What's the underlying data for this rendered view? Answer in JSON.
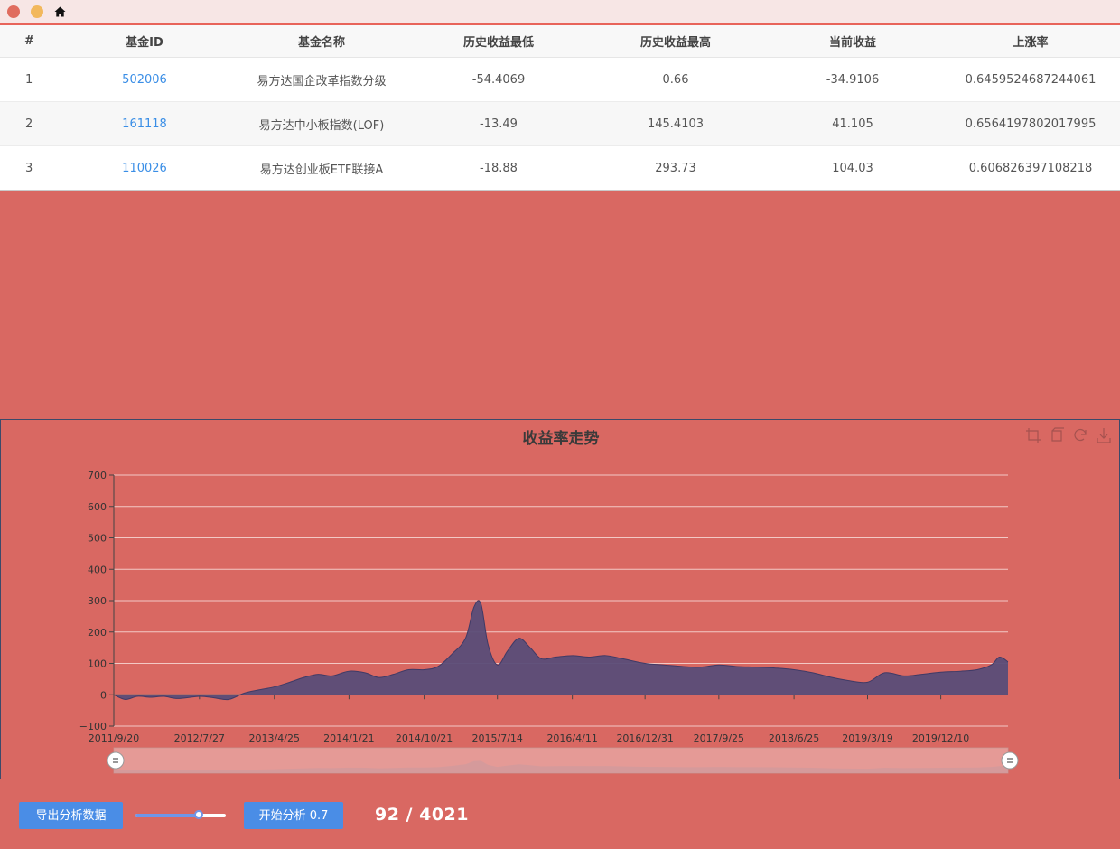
{
  "table": {
    "headers": [
      "#",
      "基金ID",
      "基金名称",
      "历史收益最低",
      "历史收益最高",
      "当前收益",
      "上涨率"
    ],
    "rows": [
      {
        "index": "1",
        "fund_id": "502006",
        "name": "易方达国企改革指数分级",
        "min": "-54.4069",
        "max": "0.66",
        "current": "-34.9106",
        "rate": "0.6459524687244061"
      },
      {
        "index": "2",
        "fund_id": "161118",
        "name": "易方达中小板指数(LOF)",
        "min": "-13.49",
        "max": "145.4103",
        "current": "41.105",
        "rate": "0.6564197802017995"
      },
      {
        "index": "3",
        "fund_id": "110026",
        "name": "易方达创业板ETF联接A",
        "min": "-18.88",
        "max": "293.73",
        "current": "104.03",
        "rate": "0.606826397108218"
      }
    ]
  },
  "controls": {
    "export_label": "导出分析数据",
    "analyze_label": "开始分析 0.7",
    "slider_value": 0.7,
    "progress_text": "92 / 4021"
  },
  "colors": {
    "background": "#d96862",
    "area_fill": "#5a4d78",
    "area_line": "#3f3a66",
    "link": "#3a8ee6",
    "button": "#4a8de6"
  },
  "chart_data": {
    "type": "area",
    "title": "收益率走势",
    "xlabel": "",
    "ylabel": "",
    "ylim": [
      -100,
      700
    ],
    "y_ticks": [
      "−100",
      "0",
      "100",
      "200",
      "300",
      "400",
      "500",
      "600",
      "700"
    ],
    "x_tick_labels": [
      "2011/9/20",
      "2012/7/27",
      "2013/4/25",
      "2014/1/21",
      "2014/10/21",
      "2015/7/14",
      "2016/4/11",
      "2016/12/31",
      "2017/9/25",
      "2018/6/25",
      "2019/3/19",
      "2019/12/10"
    ],
    "grid": true,
    "x": [
      "2011/9/20",
      "2011/11/1",
      "2011/12/15",
      "2012/2/1",
      "2012/3/20",
      "2012/5/10",
      "2012/7/27",
      "2012/9/20",
      "2012/11/10",
      "2013/1/5",
      "2013/2/25",
      "2013/4/25",
      "2013/6/20",
      "2013/8/10",
      "2013/10/1",
      "2013/11/20",
      "2014/1/21",
      "2014/3/20",
      "2014/5/10",
      "2014/7/1",
      "2014/8/25",
      "2014/10/21",
      "2014/12/10",
      "2015/1/30",
      "2015/3/20",
      "2015/4/20",
      "2015/5/15",
      "2015/6/10",
      "2015/7/14",
      "2015/8/20",
      "2015/9/30",
      "2015/11/10",
      "2015/12/20",
      "2016/2/10",
      "2016/4/11",
      "2016/6/10",
      "2016/8/10",
      "2016/10/10",
      "2016/12/31",
      "2017/3/10",
      "2017/5/20",
      "2017/7/20",
      "2017/9/25",
      "2017/12/1",
      "2018/2/10",
      "2018/4/20",
      "2018/6/25",
      "2018/9/1",
      "2018/11/10",
      "2019/1/10",
      "2019/3/19",
      "2019/5/20",
      "2019/7/30",
      "2019/10/1",
      "2019/12/10",
      "2020/2/20",
      "2020/4/20",
      "2020/6/10",
      "2020/7/10",
      "2020/8/10"
    ],
    "series": [
      {
        "values": [
          0,
          -15,
          -5,
          -8,
          -5,
          -12,
          -5,
          -10,
          -15,
          5,
          15,
          25,
          40,
          55,
          65,
          60,
          75,
          70,
          55,
          65,
          80,
          80,
          90,
          130,
          180,
          280,
          290,
          160,
          95,
          140,
          180,
          150,
          115,
          120,
          125,
          120,
          125,
          115,
          100,
          95,
          90,
          88,
          95,
          90,
          88,
          85,
          80,
          70,
          55,
          45,
          40,
          70,
          60,
          65,
          72,
          75,
          80,
          95,
          120,
          105
        ]
      }
    ]
  }
}
